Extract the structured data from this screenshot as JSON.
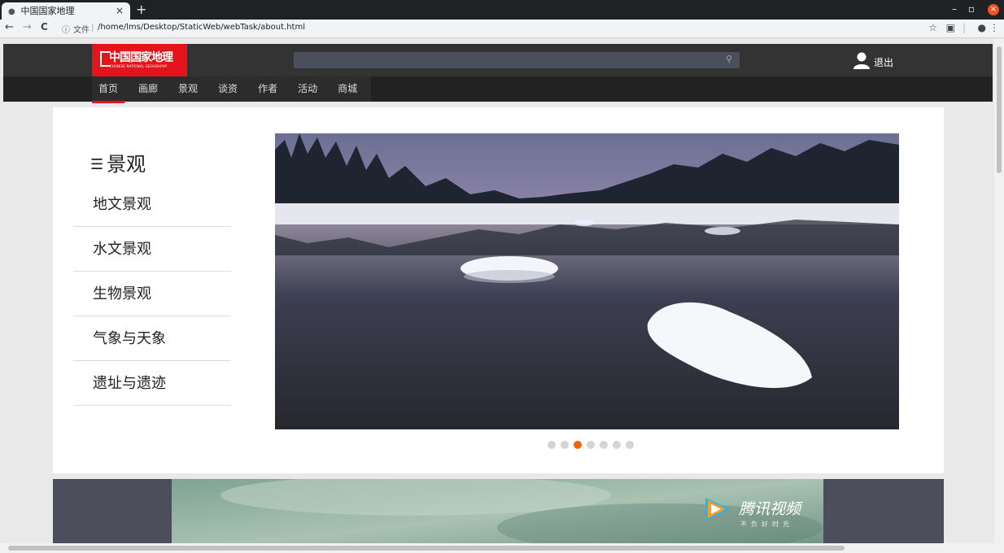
{
  "browser": {
    "tab_title": "中国国家地理",
    "tab_close": "×",
    "new_tab": "+",
    "file_label": "文件",
    "url": "/home/lms/Desktop/StaticWeb/webTask/about.html"
  },
  "header": {
    "logo_cn": "中国国家地理",
    "logo_en": "CHINESE NATIONAL GEOGRAPHY",
    "search_placeholder": "",
    "logout": "退出"
  },
  "nav": {
    "items": [
      "首页",
      "画廊",
      "景观",
      "谈资",
      "作者",
      "活动",
      "商城"
    ],
    "active_index": 0
  },
  "sidebar": {
    "title": "景观",
    "items": [
      "地文景观",
      "水文景观",
      "生物景观",
      "气象与天象",
      "遗址与遗迹"
    ]
  },
  "carousel": {
    "slide_count": 7,
    "active_index": 2
  },
  "banner": {
    "brand_name": "腾讯视频",
    "slogan": "不负好时光"
  },
  "colors": {
    "brand_red": "#e5141b",
    "header_bg": "#333333",
    "nav_bg": "#222222",
    "dot_active": "#f0640a"
  }
}
